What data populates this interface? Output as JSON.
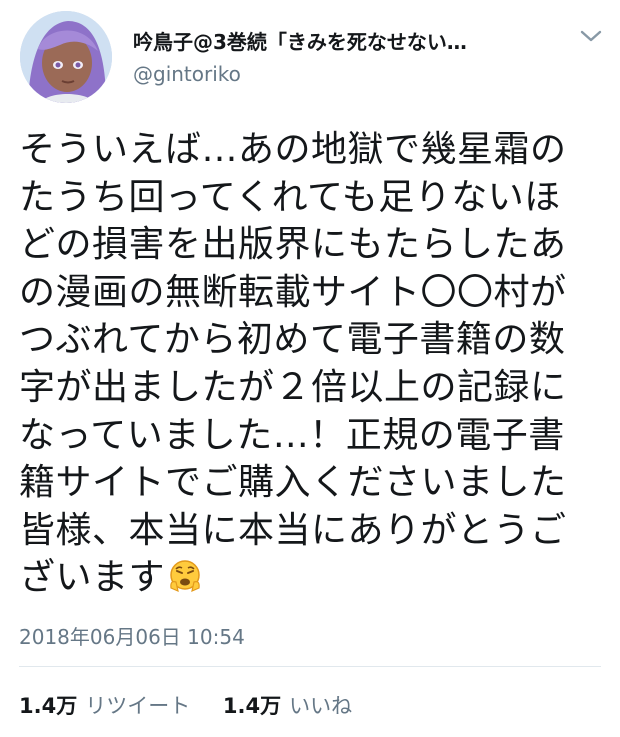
{
  "user": {
    "display_name": "吟鳥子@3巻続「きみを死なせない…",
    "handle": "@gintoriko"
  },
  "tweet": {
    "lines": [
      "そういえば…あの地獄で幾星霜の",
      "たうち回ってくれても足りないほ",
      "どの損害を出版界にもたらしたあ",
      "の漫画の無断転載サイト〇〇村が",
      "つぶれてから初めて電子書籍の数",
      "字が出ましたが２倍以上の記録に",
      "なっていました…！正規の電子書",
      "籍サイトでご購入くださいました",
      "皆様、本当に本当にありがとうご",
      "ざいます"
    ],
    "emoji": "weary-face-icon",
    "timestamp": "2018年06月06日 10:54"
  },
  "stats": {
    "retweets": "1.4万",
    "retweets_label": "リツイート",
    "likes": "1.4万",
    "likes_label": "いいね"
  },
  "colors": {
    "text": "#14171a",
    "secondary": "#657786",
    "divider": "#e1e8ed"
  }
}
